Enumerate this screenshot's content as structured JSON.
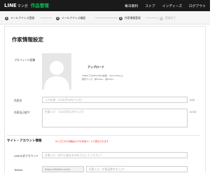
{
  "header": {
    "brand": "LINE",
    "brand_sub": "マンガ",
    "app_title": "作品管理",
    "nav": [
      "毎日無料",
      "ストア",
      "インディーズ",
      "ログアウト"
    ]
  },
  "steps": [
    {
      "number": "1",
      "label": "メールアドレス登録",
      "active": true
    },
    {
      "number": "2",
      "label": "メールアドレス確認",
      "active": true
    },
    {
      "number": "3",
      "label": "作家情報登録",
      "active": true
    },
    {
      "number": "4",
      "label": "登録完了",
      "active": false
    }
  ],
  "main": {
    "title": "作家情報設定",
    "profile": {
      "label": "プロフィール画像",
      "upload_label": "アップロード",
      "notes": [
        "2MB以下のJPEG/PNG画像、300×300以上",
        "推奨サイズ：幅640px、縦640px"
      ]
    },
    "author_name": {
      "label": "作家名",
      "placeholder": "入力必須 （20文字以内で入力）",
      "counter": "0/20"
    },
    "author_intro": {
      "label": "作家自己紹介",
      "placeholder": "任意入力 （120文字以内で入力）",
      "counter": "0/120"
    },
    "site_section": {
      "title": "サイト・アカウント情報",
      "note": "※入力された情報は以下の作品ページに表示されます"
    },
    "line_account": {
      "label": "LINE公式アカウント",
      "placeholder": "任意入力（@から始まるIDを入力してください）"
    },
    "twitter": {
      "label": "Twitter",
      "prefix": "https://twitter.com/",
      "placeholder": "任意入力（半角英数字を入力）"
    }
  }
}
